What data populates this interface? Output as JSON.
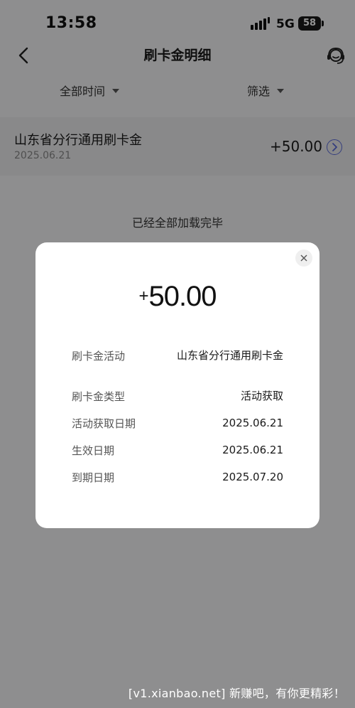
{
  "status_bar": {
    "time": "13:58",
    "network": "5G",
    "battery": "58"
  },
  "nav": {
    "title": "刷卡金明细",
    "back_icon": "chevron-left-icon",
    "service_icon": "customer-service-icon"
  },
  "filters": {
    "time_label": "全部时间",
    "screen_label": "筛选"
  },
  "record": {
    "title": "山东省分行通用刷卡金",
    "date": "2025.06.21",
    "amount": "+50.00"
  },
  "list_end_text": "已经全部加载完毕",
  "modal": {
    "amount_sign": "+",
    "amount_value": "50.00",
    "details": [
      {
        "label": "刷卡金活动",
        "value": "山东省分行通用刷卡金"
      },
      {
        "label": "刷卡金类型",
        "value": "活动获取"
      },
      {
        "label": "活动获取日期",
        "value": "2025.06.21"
      },
      {
        "label": "生效日期",
        "value": "2025.06.21"
      },
      {
        "label": "到期日期",
        "value": "2025.07.20"
      }
    ]
  },
  "watermark": "[v1.xianbao.net] 新赚吧，有你更精彩！",
  "colors": {
    "accent_arrow": "#5a6ad8",
    "overlay": "rgba(0,0,0,0.42)"
  }
}
